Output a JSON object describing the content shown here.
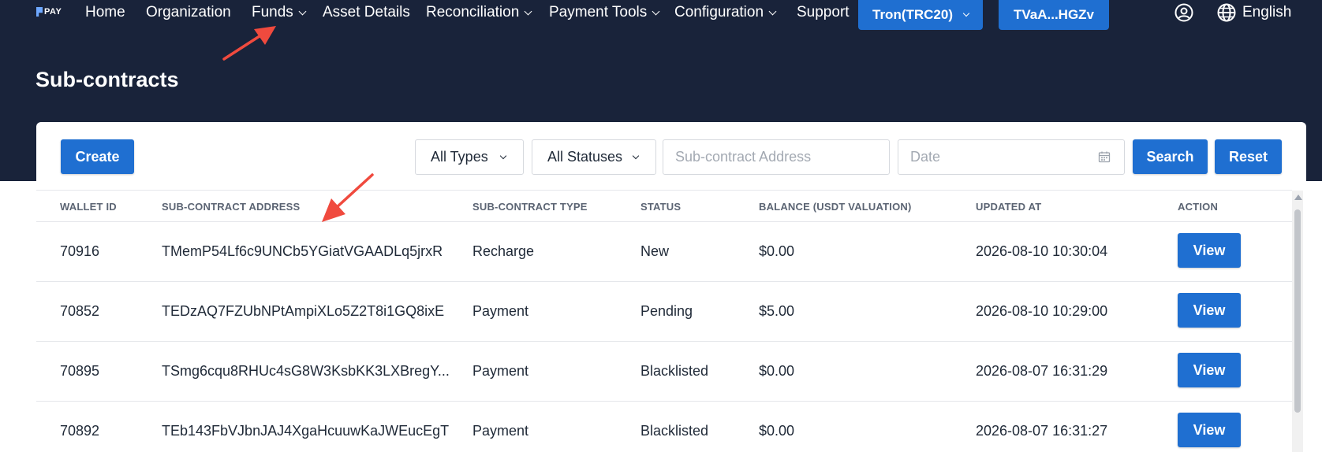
{
  "brand": {
    "logo_text": "PAY"
  },
  "nav": {
    "items": [
      {
        "label": "Home",
        "has_dropdown": false
      },
      {
        "label": "Organization",
        "has_dropdown": false
      },
      {
        "label": "Funds",
        "has_dropdown": true
      },
      {
        "label": "Asset Details",
        "has_dropdown": false
      },
      {
        "label": "Reconciliation",
        "has_dropdown": true
      },
      {
        "label": "Payment Tools",
        "has_dropdown": true
      },
      {
        "label": "Configuration",
        "has_dropdown": true
      },
      {
        "label": "Support",
        "has_dropdown": false
      }
    ],
    "network_label": "Tron(TRC20)",
    "wallet_label": "TVaA...HGZv",
    "language_label": "English"
  },
  "page": {
    "title": "Sub-contracts"
  },
  "toolbar": {
    "create_label": "Create",
    "type_select": "All Types",
    "status_select": "All Statuses",
    "address_placeholder": "Sub-contract Address",
    "date_placeholder": "Date",
    "search_label": "Search",
    "reset_label": "Reset"
  },
  "table": {
    "columns": [
      "WALLET ID",
      "SUB-CONTRACT ADDRESS",
      "SUB-CONTRACT TYPE",
      "STATUS",
      "BALANCE (USDT VALUATION)",
      "UPDATED AT",
      "ACTION"
    ],
    "rows": [
      {
        "wallet_id": "70916",
        "address": "TMemP54Lf6c9UNCb5YGiatVGAADLq5jrxR",
        "type": "Recharge",
        "status": "New",
        "balance": "$0.00",
        "updated_at": "2026-08-10 10:30:04",
        "action": "View"
      },
      {
        "wallet_id": "70852",
        "address": "TEDzAQ7FZUbNPtAmpiXLo5Z2T8i1GQ8ixE",
        "type": "Payment",
        "status": "Pending",
        "balance": "$5.00",
        "updated_at": "2026-08-10 10:29:00",
        "action": "View"
      },
      {
        "wallet_id": "70895",
        "address": "TSmg6cqu8RHUc4sG8W3KsbKK3LXBregY...",
        "type": "Payment",
        "status": "Blacklisted",
        "balance": "$0.00",
        "updated_at": "2026-08-07 16:31:29",
        "action": "View"
      },
      {
        "wallet_id": "70892",
        "address": "TEb143FbVJbnJAJ4XgaHcuuwKaJWEucEgT",
        "type": "Payment",
        "status": "Blacklisted",
        "balance": "$0.00",
        "updated_at": "2026-08-07 16:31:27",
        "action": "View"
      }
    ]
  },
  "colors": {
    "header_bg": "#19233a",
    "primary": "#1f6fd1",
    "annotation_arrow": "#f04a3e"
  },
  "icons": {
    "user": "user-circle-icon",
    "language": "globe-icon",
    "calendar": "calendar-icon",
    "dropdown": "chevron-down-icon"
  }
}
